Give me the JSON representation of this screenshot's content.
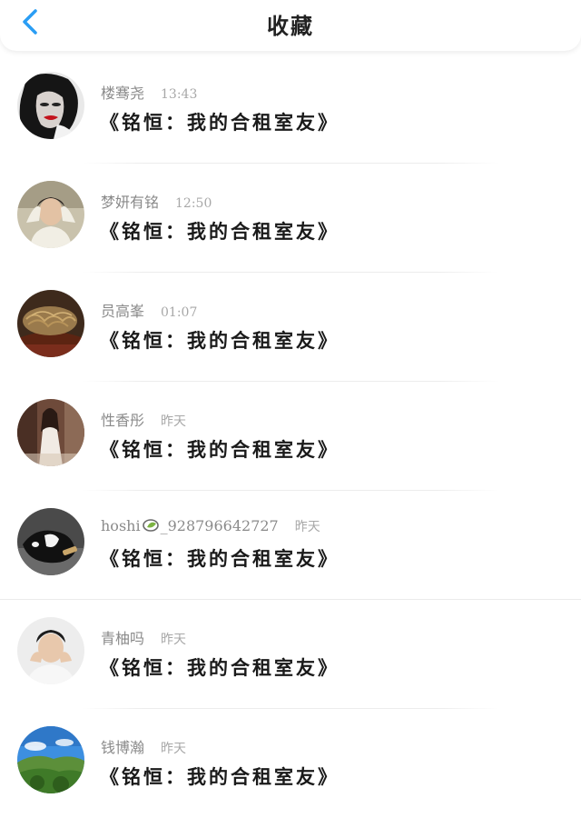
{
  "header": {
    "title": "收藏",
    "back_icon": "chevron-left-icon",
    "accent_color": "#2a9df4"
  },
  "items": [
    {
      "name": "楼骞尧",
      "time": "13:43",
      "message": "《铭恒：我的合租室友》",
      "avatar": "avatar-woman-red-lips"
    },
    {
      "name": "梦妍有铭",
      "time": "12:50",
      "message": "《铭恒：我的合租室友》",
      "avatar": "avatar-man-hands-behind-head"
    },
    {
      "name": "员高峯",
      "time": "01:07",
      "message": "《铭恒：我的合租室友》",
      "avatar": "avatar-noodles"
    },
    {
      "name": "性香彤",
      "time": "昨天",
      "message": "《铭恒：我的合租室友》",
      "avatar": "avatar-girl-white-dress"
    },
    {
      "name_prefix": "hoshi",
      "name_suffix": "_928796642727",
      "name_icon": "leaf-icon",
      "time": "昨天",
      "message": "《铭恒：我的合租室友》",
      "avatar": "avatar-black-white-dog"
    },
    {
      "name": "青柚吗",
      "time": "昨天",
      "message": "《铭恒：我的合租室友》",
      "avatar": "avatar-boy-hands-on-face"
    },
    {
      "name": "钱博瀚",
      "time": "昨天",
      "message": "《铭恒：我的合租室友》",
      "avatar": "avatar-green-landscape"
    }
  ]
}
